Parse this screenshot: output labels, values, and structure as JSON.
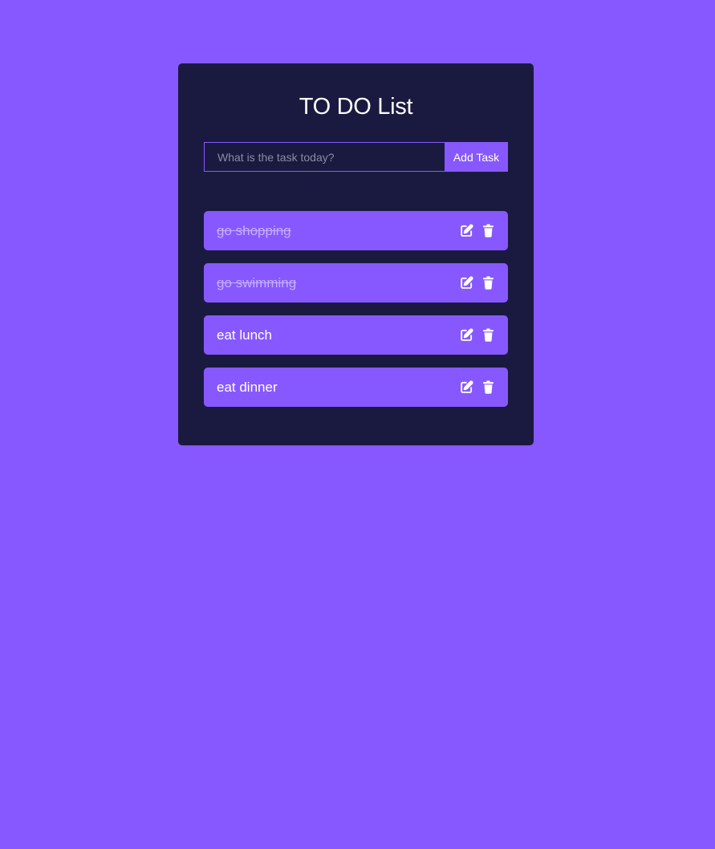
{
  "app": {
    "title": "TO DO List"
  },
  "form": {
    "placeholder": "What is the task today?",
    "value": "",
    "add_label": "Add Task"
  },
  "tasks": [
    {
      "text": "go shopping",
      "completed": true
    },
    {
      "text": "go swimming",
      "completed": true
    },
    {
      "text": "eat lunch",
      "completed": false
    },
    {
      "text": "eat dinner",
      "completed": false
    }
  ],
  "icons": {
    "edit": "edit-icon",
    "delete": "trash-icon"
  },
  "colors": {
    "background": "#8758ff",
    "card": "#1a1a40",
    "accent": "#8758ff",
    "text": "#ffffff",
    "completed_text": "#c5aeff"
  }
}
